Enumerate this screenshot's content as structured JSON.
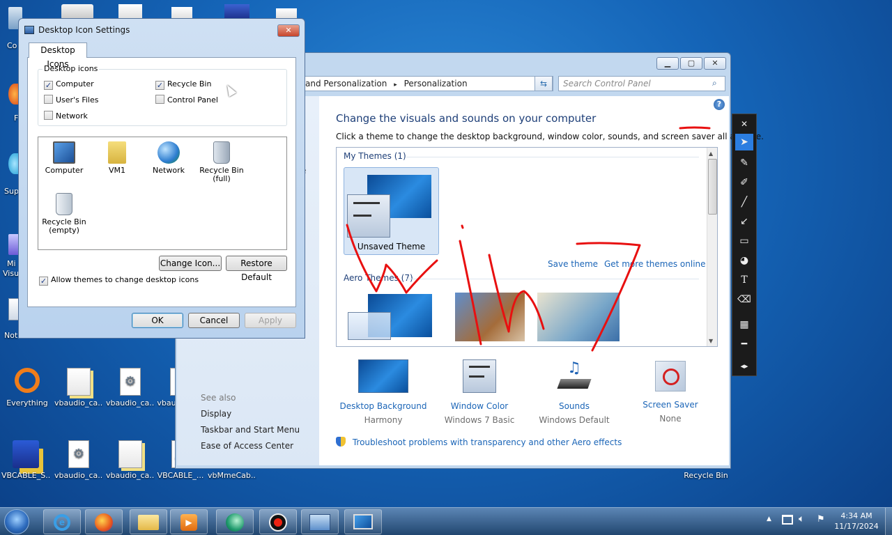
{
  "desktop": {
    "icons_left_visible_fragments": [
      "Co",
      "F",
      "Sup",
      "Mi",
      "Visu",
      "Not"
    ],
    "icons_row1": [
      {
        "label": "Everything",
        "icon": "everything-icon"
      },
      {
        "label": "vbaudio_ca...",
        "icon": "package-icon"
      },
      {
        "label": "vbaudio_ca...",
        "icon": "settings-file-icon"
      },
      {
        "label": "vbau",
        "icon": "file-icon"
      }
    ],
    "icons_row2": [
      {
        "label": "VBCABLE_S...",
        "icon": "floppy-setup-icon"
      },
      {
        "label": "vbaudio_ca...",
        "icon": "settings-file-icon"
      },
      {
        "label": "vbaudio_ca...",
        "icon": "package-icon"
      },
      {
        "label": "VBCABLE_...",
        "icon": "app-icon"
      },
      {
        "label": "vbMmeCab...",
        "icon": "file-icon"
      }
    ],
    "recycle_bin_label": "Recycle Bin"
  },
  "control_panel": {
    "breadcrumb_part1": "and Personalization",
    "breadcrumb_sep": "▸",
    "breadcrumb_part2": "Personalization",
    "search_placeholder": "Search Control Panel",
    "heading": "Change the visuals and sounds on your computer",
    "subheading": "Click a theme to change the desktop background, window color, sounds, and screen saver all at once.",
    "my_themes_label": "My Themes (1)",
    "unsaved_theme_label": "Unsaved Theme",
    "save_theme_link": "Save theme",
    "get_more_link": "Get more themes online",
    "aero_themes_label": "Aero Themes (7)",
    "see_also_label": "See also",
    "left_links": [
      "Display",
      "Taskbar and Start Menu",
      "Ease of Access Center"
    ],
    "bottom_items": [
      {
        "title": "Desktop Background",
        "value": "Harmony",
        "icon": "desktop-background-icon"
      },
      {
        "title": "Window Color",
        "value": "Windows 7 Basic",
        "icon": "window-color-icon"
      },
      {
        "title": "Sounds",
        "value": "Windows Default",
        "icon": "sounds-icon"
      },
      {
        "title": "Screen Saver",
        "value": "None",
        "icon": "screen-saver-icon"
      }
    ],
    "troubleshoot_link": "Troubleshoot problems with transparency and other Aero effects",
    "partial_fragment": "e"
  },
  "dialog": {
    "title": "Desktop Icon Settings",
    "tab_label": "Desktop Icons",
    "group_label": "Desktop icons",
    "checkboxes": [
      {
        "label": "Computer",
        "checked": true
      },
      {
        "label": "Recycle Bin",
        "checked": true
      },
      {
        "label": "User's Files",
        "checked": false
      },
      {
        "label": "Control Panel",
        "checked": false
      },
      {
        "label": "Network",
        "checked": false
      }
    ],
    "icon_items": [
      {
        "label": "Computer",
        "icon": "computer-icon"
      },
      {
        "label": "VM1",
        "icon": "user-folder-icon"
      },
      {
        "label": "Network",
        "icon": "network-icon"
      },
      {
        "label": "Recycle Bin (full)",
        "label_line1": "Recycle Bin",
        "label_line2": "(full)",
        "icon": "recycle-bin-full-icon"
      },
      {
        "label": "Recycle Bin (empty)",
        "label_line1": "Recycle Bin",
        "label_line2": "(empty)",
        "icon": "recycle-bin-empty-icon"
      }
    ],
    "change_icon_label": "Change Icon...",
    "restore_default_label": "Restore Default",
    "allow_themes_label": "Allow themes to change desktop icons",
    "allow_themes_checked": true,
    "ok_label": "OK",
    "cancel_label": "Cancel",
    "apply_label": "Apply"
  },
  "taskbar": {
    "time": "4:34 AM",
    "date": "11/17/2024",
    "apps": [
      "start-orb-icon",
      "internet-explorer-icon",
      "firefox-icon",
      "explorer-icon",
      "media-player-icon",
      "chrome-like-icon",
      "record-icon",
      "control-panel-icon",
      "display-icon"
    ]
  },
  "annotation_toolbar": {
    "tools": [
      "close-icon",
      "pointer-icon",
      "pen-icon",
      "highlighter-icon",
      "line-icon",
      "arrow-icon",
      "rectangle-icon",
      "color-icon",
      "text-icon",
      "eraser-icon",
      "pattern-icon",
      "stroke-icon",
      "swap-icon"
    ]
  },
  "colors": {
    "accent": "#1b65b7",
    "desktop": "#1565b8",
    "ink": "#e81010"
  }
}
